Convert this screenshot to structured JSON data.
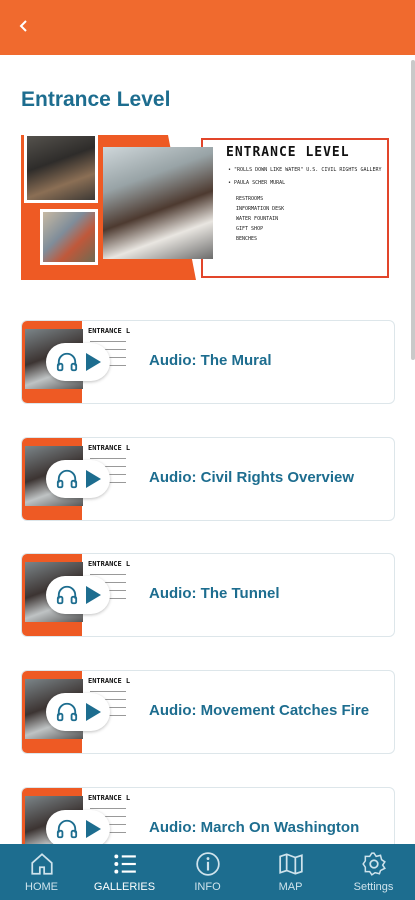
{
  "header": {
    "back_icon": "chevron-left-icon",
    "accent": "#f06a2e"
  },
  "page_title": "Entrance Level",
  "hero": {
    "heading": "ENTRANCE LEVEL",
    "lines": [
      "• \"ROLLS DOWN LIKE WATER\" U.S. CIVIL RIGHTS GALLERY",
      "• PAULA SCHER MURAL",
      "RESTROOMS",
      "INFORMATION DESK",
      "WATER FOUNTAIN",
      "GIFT SHOP",
      "BENCHES"
    ]
  },
  "thumb_heading": "ENTRANCE L",
  "cards": [
    {
      "label": "Audio: The Mural"
    },
    {
      "label": "Audio: Civil Rights Overview"
    },
    {
      "label": "Audio: The Tunnel"
    },
    {
      "label": "Audio: Movement Catches Fire"
    },
    {
      "label": "Audio: March On Washington"
    }
  ],
  "nav": {
    "items": [
      {
        "label": "HOME",
        "icon": "home-icon"
      },
      {
        "label": "GALLERIES",
        "icon": "list-icon",
        "active": true
      },
      {
        "label": "INFO",
        "icon": "info-icon"
      },
      {
        "label": "MAP",
        "icon": "map-icon"
      },
      {
        "label": "Settings",
        "icon": "gear-icon"
      }
    ],
    "bg": "#1d6d8f"
  }
}
